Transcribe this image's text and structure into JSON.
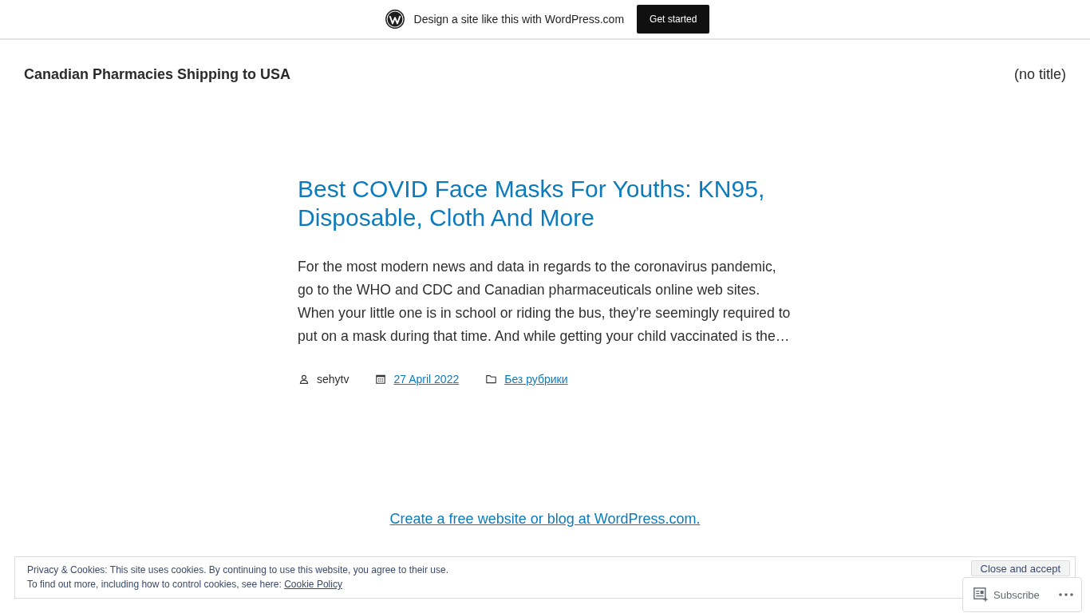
{
  "promo_bar": {
    "text": "Design a site like this with WordPress.com",
    "button": "Get started"
  },
  "header": {
    "site_title": "Canadian Pharmacies Shipping to USA",
    "nav": [
      {
        "label": "(no title)"
      }
    ]
  },
  "post": {
    "title": "Best COVID Face Masks For Youths: KN95, Disposable, Cloth And More",
    "excerpt": "For the most modern news and data in regards to the coronavirus pandemic, go to the WHO and CDC and Canadian pharmaceuticals online web sites. When your little one is in school or riding the bus, they’re seemingly required to put on a mask during that time. And while getting your child vaccinated is the…",
    "meta": [
      {
        "kind": "author",
        "text": "sehytv"
      },
      {
        "kind": "date",
        "text": "27 April 2022"
      },
      {
        "kind": "category",
        "text": "Без рубрики"
      }
    ]
  },
  "footer": {
    "link": "Create a free website or blog at WordPress.com."
  },
  "cookie_banner": {
    "line_1": "Privacy & Cookies: This site uses cookies. By continuing to use this website, you agree to their use.",
    "line_2": "To find out more, including how to control cookies, see here:",
    "link": "Cookie Policy",
    "button": "Close and accept"
  },
  "subscribe_bar": {
    "label": "Subscribe"
  }
}
